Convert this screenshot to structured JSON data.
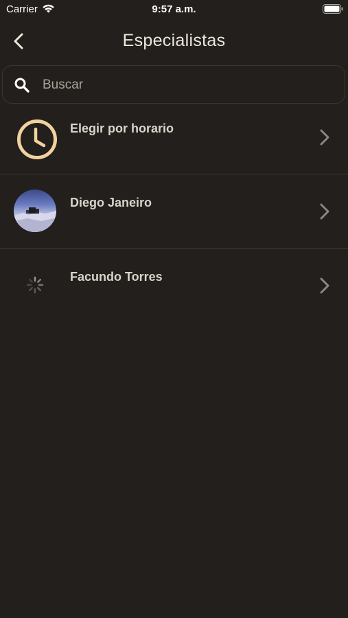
{
  "status_bar": {
    "carrier": "Carrier",
    "time": "9:57 a.m."
  },
  "nav": {
    "title": "Especialistas"
  },
  "search": {
    "placeholder": "Buscar",
    "value": ""
  },
  "list": {
    "items": [
      {
        "label": "Elegir por horario",
        "icon": "clock-icon"
      },
      {
        "label": "Diego Janeiro",
        "icon": "avatar-photo"
      },
      {
        "label": "Facundo Torres",
        "icon": "loading-spinner-icon"
      }
    ]
  },
  "colors": {
    "background": "#221f1c",
    "accent_clock": "#f1d29e",
    "text": "#e9e4dc",
    "chevron": "#8b8680"
  }
}
